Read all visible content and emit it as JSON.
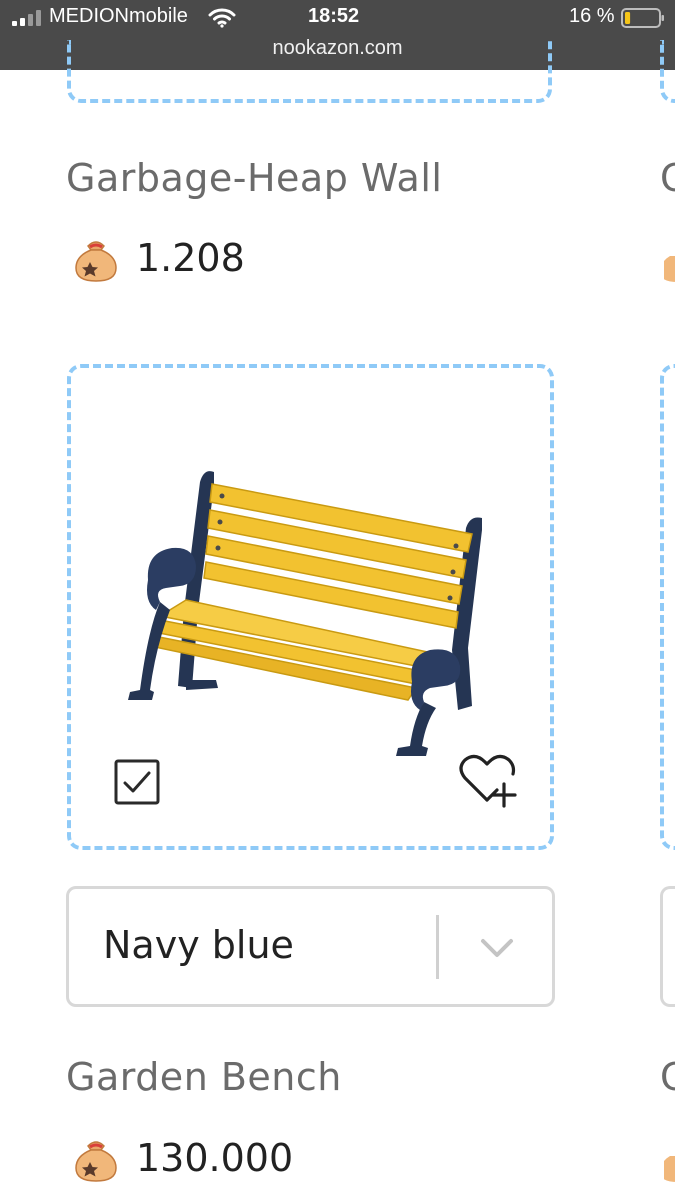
{
  "status_bar": {
    "carrier": "MEDIONmobile",
    "time": "18:52",
    "battery_percent": "16 %",
    "battery_level": 0.16,
    "domain": "nookazon.com"
  },
  "items": [
    {
      "name": "Garbage-Heap Wall",
      "price": "1.208",
      "currency_icon": "bell-bag-icon"
    },
    {
      "name": "Garden Bench",
      "price": "130.000",
      "currency_icon": "bell-bag-icon",
      "image": "garden-bench-image",
      "variant": "Navy blue",
      "checkbox_checked": true,
      "wishlist_icon": "heart-plus-icon"
    }
  ],
  "next_column_peek": {
    "name_initial_1": "C",
    "name_initial_2": "C"
  },
  "colors": {
    "dashed_border": "#8fcaf7",
    "status_bar_bg": "#4a4a4a",
    "bench_wood": "#f2c230",
    "bench_frame": "#253553"
  }
}
